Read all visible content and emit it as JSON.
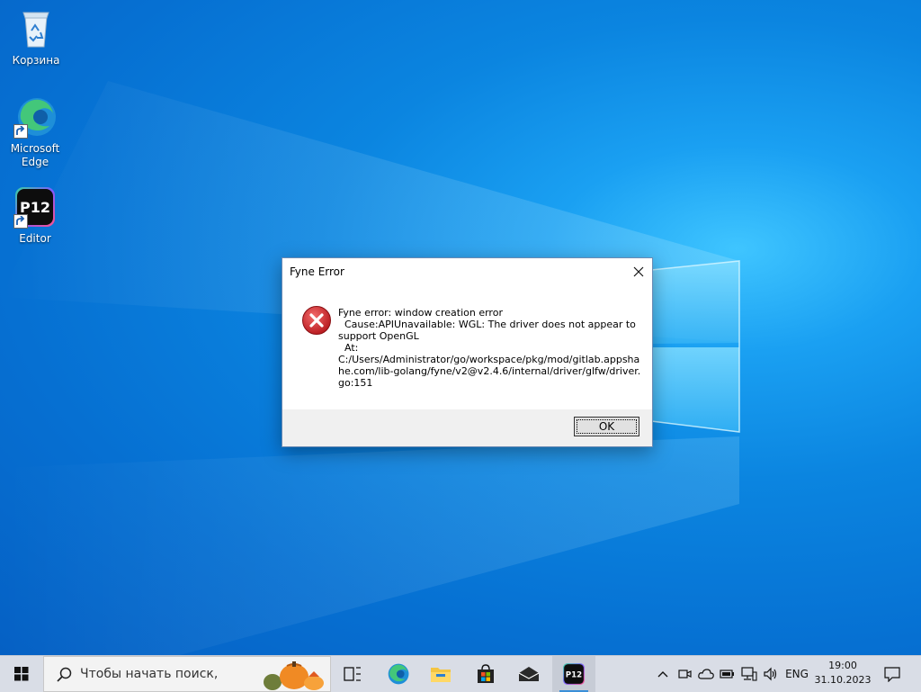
{
  "desktop": {
    "icons": [
      {
        "label": "Корзина",
        "icon": "recycle-bin-icon"
      },
      {
        "label": "Microsoft\nEdge",
        "icon": "edge-icon"
      },
      {
        "label": "Editor",
        "icon": "p12-editor-icon"
      }
    ],
    "p12_logo_text": "P12"
  },
  "dialog": {
    "title": "Fyne Error",
    "message_lines": [
      "Fyne error: window creation error",
      "  Cause:APIUnavailable: WGL: The driver does not appear to",
      "support OpenGL",
      "  At:",
      "C:/Users/Administrator/go/workspace/pkg/mod/gitlab.appsha",
      "he.com/lib-golang/fyne/v2@v2.4.6/internal/driver/glfw/driver.",
      "go:151"
    ],
    "ok_label": "OK"
  },
  "taskbar": {
    "search_placeholder": "Чтобы начать поиск,",
    "apps": [
      "task-view-icon",
      "edge-icon",
      "file-explorer-icon",
      "store-icon",
      "mail-icon",
      "p12-editor-icon"
    ],
    "p12_label": "P12",
    "tray": {
      "language": "ENG",
      "time": "19:00",
      "date": "31.10.2023"
    }
  },
  "colors": {
    "accent": "#0078d7",
    "error_red": "#d13438",
    "taskbar_bg": "#d9dde6"
  }
}
